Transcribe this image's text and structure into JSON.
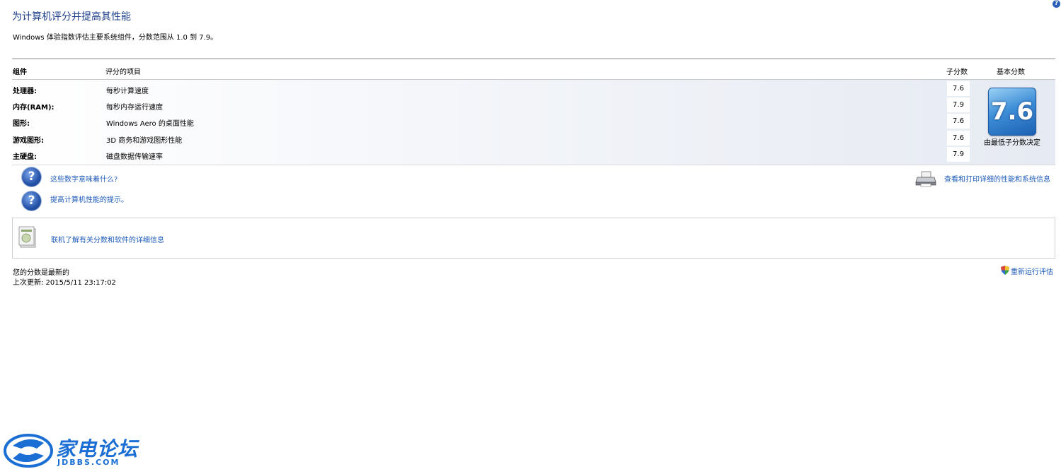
{
  "header": {
    "help_glyph": "?",
    "title": "为计算机评分并提高其性能",
    "subtitle": "Windows 体验指数评估主要系统组件，分数范围从 1.0 到 7.9。"
  },
  "table": {
    "columns": {
      "component": "组件",
      "rated_item": "评分的项目",
      "subscore": "子分数",
      "base_score": "基本分数"
    },
    "rows": [
      {
        "component": "处理器:",
        "item": "每秒计算速度",
        "subscore": "7.6"
      },
      {
        "component": "内存(RAM):",
        "item": "每秒内存运行速度",
        "subscore": "7.9"
      },
      {
        "component": "图形:",
        "item": "Windows Aero 的桌面性能",
        "subscore": "7.6"
      },
      {
        "component": "游戏图形:",
        "item": "3D 商务和游戏图形性能",
        "subscore": "7.6"
      },
      {
        "component": "主硬盘:",
        "item": "磁盘数据传输速率",
        "subscore": "7.9"
      }
    ],
    "base_score": "7.6",
    "base_caption": "由最低子分数决定"
  },
  "links": {
    "what_numbers_mean": "这些数字意味着什么?",
    "improve_tips": "提高计算机性能的提示。",
    "print_details": "查看和打印详细的性能和系统信息",
    "online_info": "联机了解有关分数和软件的详细信息",
    "rerun": "重新运行评估"
  },
  "status": {
    "line1": "您的分数是最新的",
    "line2": "上次更新: 2015/5/11 23:17:02"
  },
  "watermark": {
    "title": "家电论坛",
    "site": "JDBBS.COM"
  },
  "colors": {
    "link": "#1d5ab8",
    "title": "#1e3f8a",
    "badge": "#3f8fd8",
    "watermark": "#1b6fd4"
  }
}
